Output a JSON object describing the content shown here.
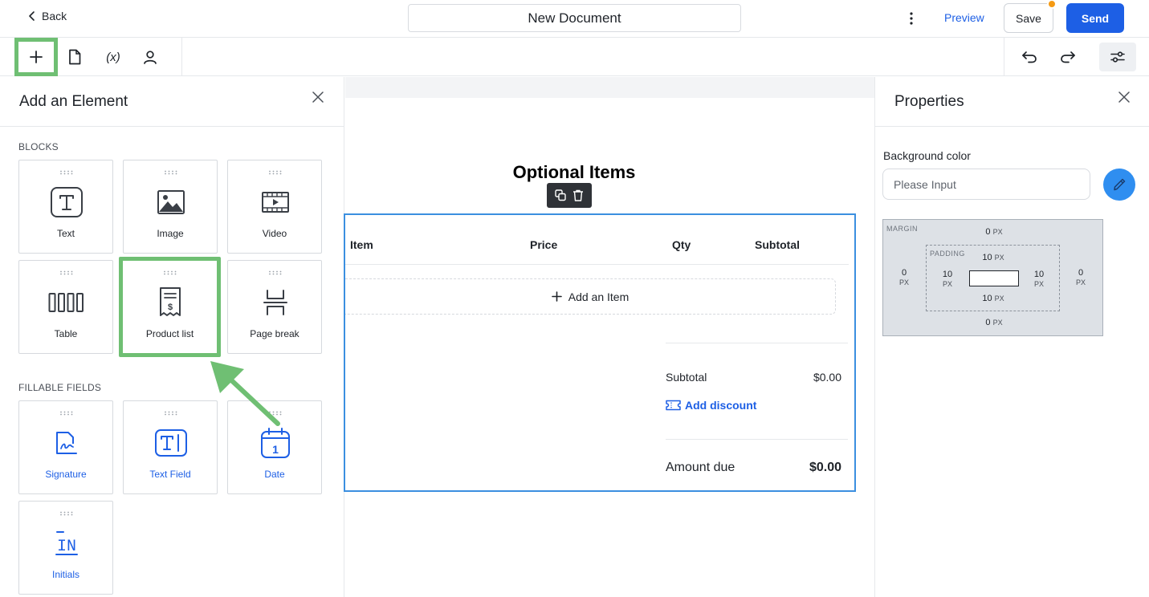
{
  "header": {
    "back_label": "Back",
    "document_title": "New Document",
    "preview_label": "Preview",
    "save_label": "Save",
    "send_label": "Send"
  },
  "toolbar": {
    "variables_label": "(x)"
  },
  "left_panel": {
    "title": "Add an Element",
    "blocks_label": "BLOCKS",
    "blocks": [
      {
        "label": "Text",
        "icon": "text-icon"
      },
      {
        "label": "Image",
        "icon": "image-icon"
      },
      {
        "label": "Video",
        "icon": "video-icon"
      },
      {
        "label": "Table",
        "icon": "table-icon"
      },
      {
        "label": "Product list",
        "icon": "product-list-icon"
      },
      {
        "label": "Page break",
        "icon": "page-break-icon"
      }
    ],
    "fillable_label": "FILLABLE FIELDS",
    "fields": [
      {
        "label": "Signature",
        "icon": "signature-icon"
      },
      {
        "label": "Text Field",
        "icon": "text-field-icon"
      },
      {
        "label": "Date",
        "icon": "date-icon"
      },
      {
        "label": "Initials",
        "icon": "initials-icon"
      }
    ],
    "date_icon_text": "1",
    "initials_icon_text": "IN"
  },
  "canvas": {
    "heading": "Optional Items",
    "columns": [
      "Item",
      "Price",
      "Qty",
      "Subtotal"
    ],
    "add_item_label": "Add an Item",
    "subtotal_label": "Subtotal",
    "subtotal_value": "$0.00",
    "discount_label": "Add discount",
    "amount_due_label": "Amount due",
    "amount_due_value": "$0.00"
  },
  "right_panel": {
    "title": "Properties",
    "background_color_label": "Background color",
    "background_color_placeholder": "Please Input",
    "box_model": {
      "margin_label": "MARGIN",
      "padding_label": "PADDING",
      "unit": "PX",
      "margin": {
        "top": "0",
        "right": "0",
        "bottom": "0",
        "left": "0"
      },
      "padding": {
        "top": "10",
        "right": "10",
        "bottom": "10",
        "left": "10"
      }
    }
  },
  "colors": {
    "primary": "#1d5fe5",
    "highlight": "#6fbf73",
    "notification_dot": "#f59a13",
    "selection": "#3b8fe0",
    "picker": "#2f8ef0"
  }
}
